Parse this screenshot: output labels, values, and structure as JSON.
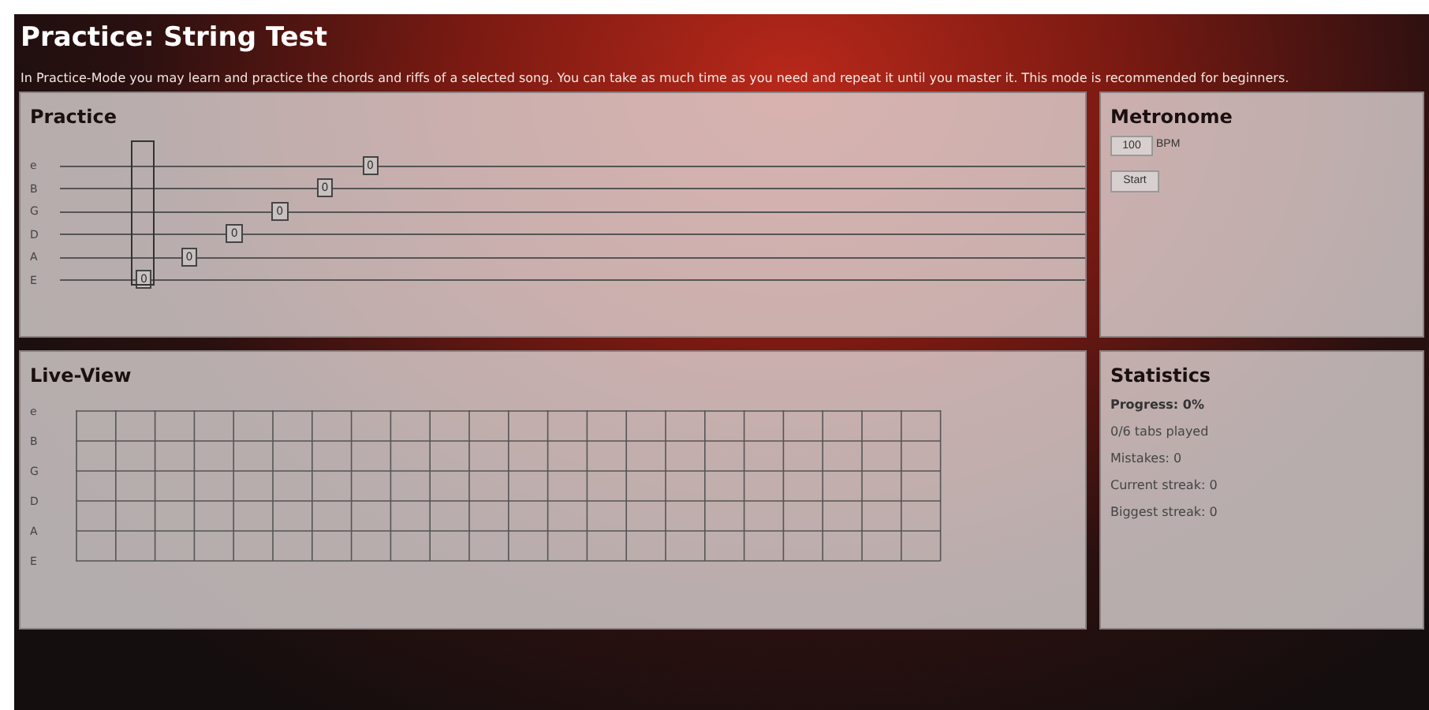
{
  "header": {
    "title": "Practice: String Test",
    "description": "In Practice-Mode you may learn and practice the chords and riffs of a selected song. You can take as much time as you need and repeat it until you master it. This mode is recommended for beginners."
  },
  "practice": {
    "title": "Practice",
    "strings": [
      {
        "label": "e",
        "cells": [
          null,
          null,
          null,
          null,
          null,
          "0"
        ]
      },
      {
        "label": "B",
        "cells": [
          null,
          null,
          null,
          null,
          "0",
          null
        ]
      },
      {
        "label": "G",
        "cells": [
          null,
          null,
          null,
          "0",
          null,
          null
        ]
      },
      {
        "label": "D",
        "cells": [
          null,
          null,
          "0",
          null,
          null,
          null
        ]
      },
      {
        "label": "A",
        "cells": [
          null,
          "0",
          null,
          null,
          null,
          null
        ]
      },
      {
        "label": "E",
        "cells": [
          "0",
          null,
          null,
          null,
          null,
          null
        ]
      }
    ]
  },
  "metronome": {
    "title": "Metronome",
    "bpm": "100",
    "unit": "BPM",
    "button": "Start"
  },
  "live_view": {
    "title": "Live-View",
    "strings": [
      "e",
      "B",
      "G",
      "D",
      "A",
      "E"
    ]
  },
  "statistics": {
    "title": "Statistics",
    "progress": "Progress: 0%",
    "lines": [
      "0/6 tabs played",
      "Mistakes: 0",
      "Current streak: 0",
      "Biggest streak: 0"
    ]
  }
}
